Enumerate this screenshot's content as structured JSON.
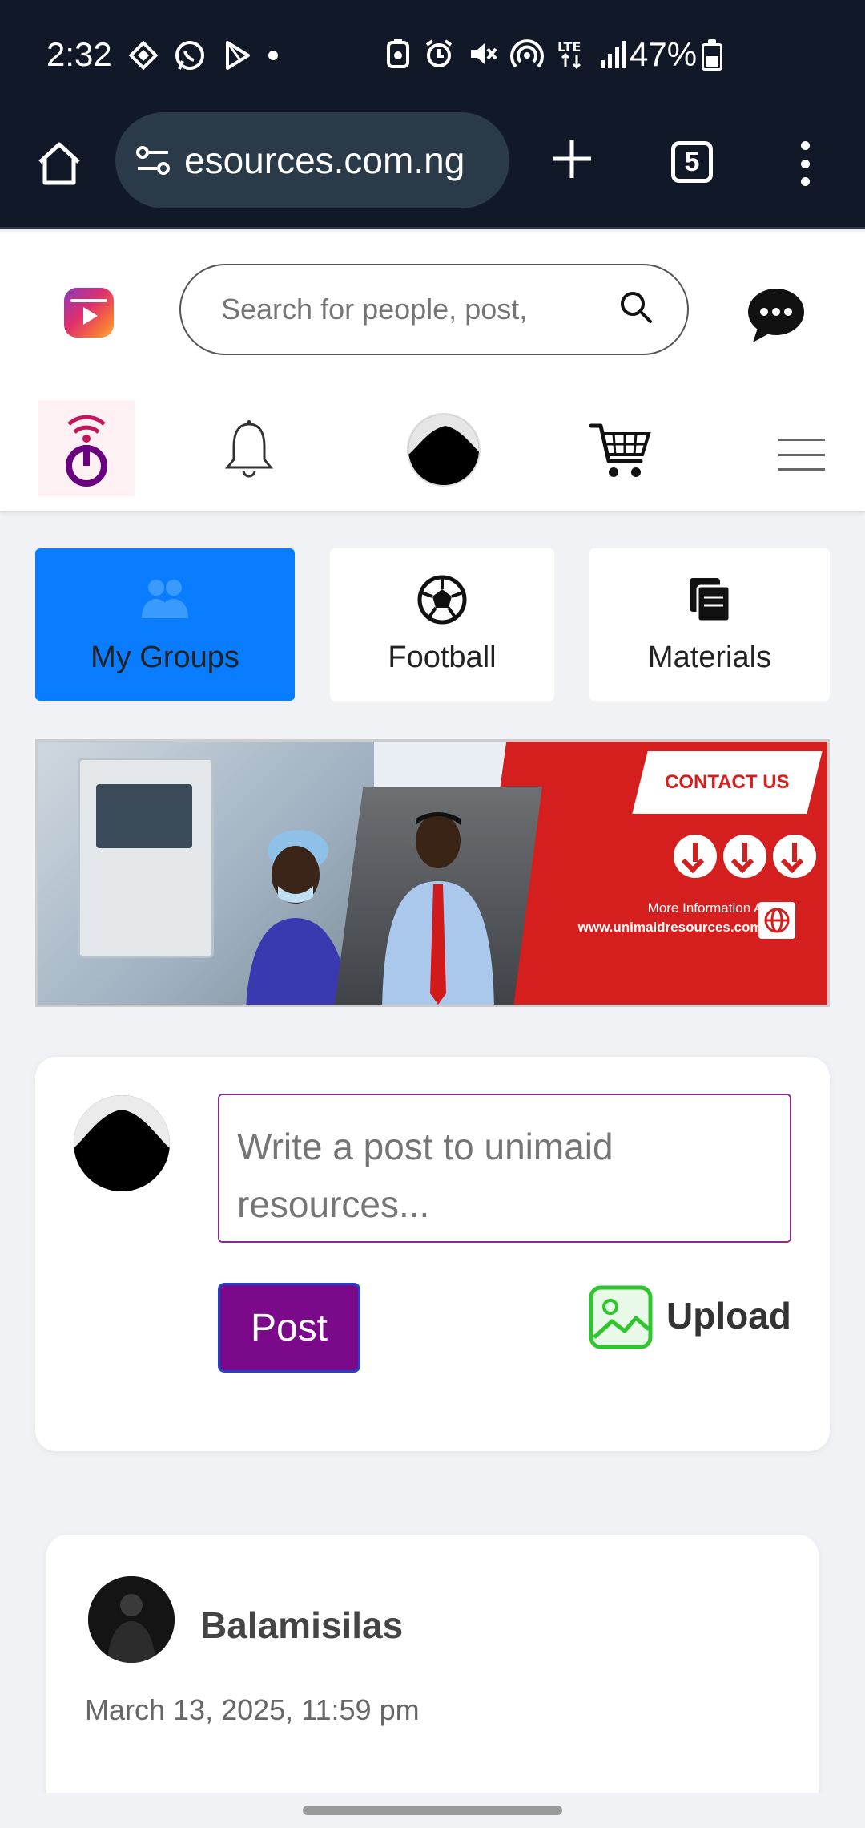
{
  "status_bar": {
    "time": "2:32",
    "battery_text": "47%",
    "battery_level": 0.47
  },
  "browser": {
    "url": "esources.com.ng",
    "tab_count": "5"
  },
  "header": {
    "search_placeholder": "Search for people, post,"
  },
  "categories": [
    {
      "label": "My Groups",
      "icon": "groups-icon",
      "active": true
    },
    {
      "label": "Football",
      "icon": "football-icon",
      "active": false
    },
    {
      "label": "Materials",
      "icon": "materials-icon",
      "active": false
    }
  ],
  "banner": {
    "contact": "CONTACT US",
    "more_info": "More Information At",
    "url": "www.unimaidresources.com.ng"
  },
  "compose": {
    "placeholder": "Write a post to unimaid resources...",
    "post_label": "Post",
    "upload_label": "Upload"
  },
  "feed": [
    {
      "author": "Balamisilas",
      "date": "March 13, 2025, 11:59 pm"
    }
  ],
  "colors": {
    "accent_blue": "#0a7cff",
    "post_button": "#7a0a8a",
    "banner_red": "#d51e1e"
  }
}
